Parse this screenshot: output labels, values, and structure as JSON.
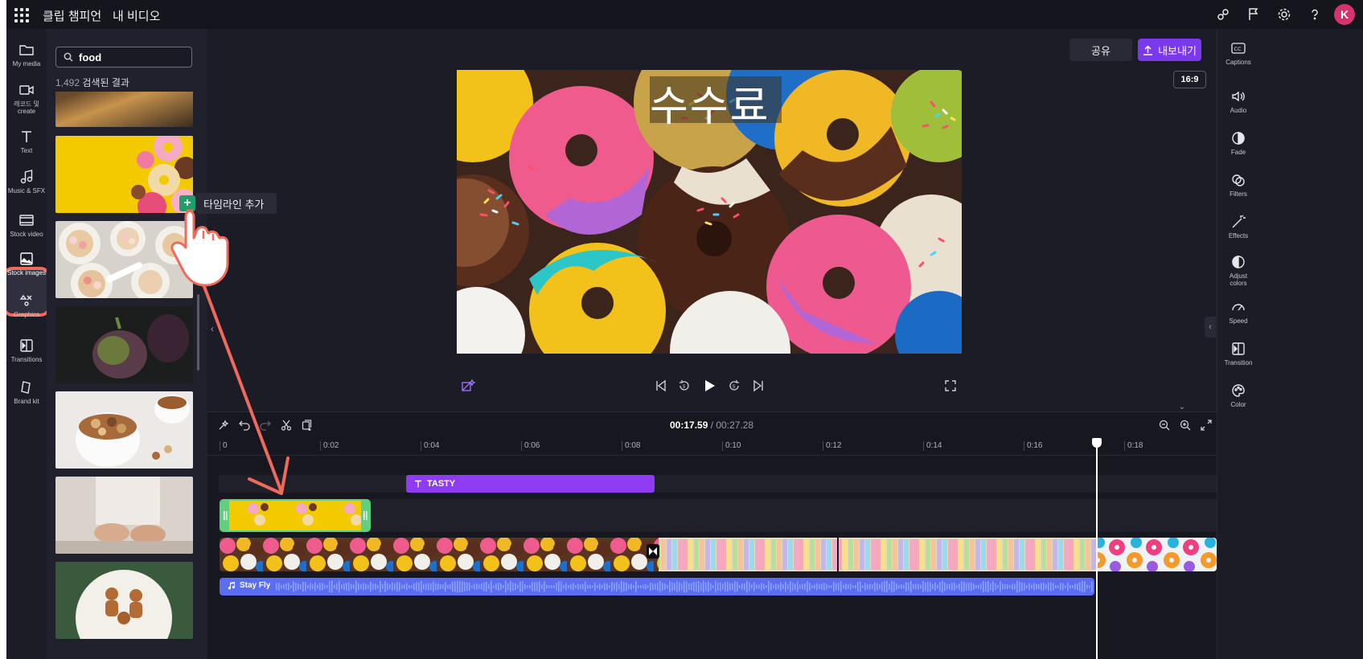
{
  "app": {
    "name": "클립 챔피언",
    "project": "내 비디오",
    "avatar_initial": "K"
  },
  "left_nav": [
    {
      "label": "My media",
      "icon": "folder-icon"
    },
    {
      "label": "레코드 및 create",
      "icon": "camera-icon"
    },
    {
      "label": "Text",
      "icon": "text-icon"
    },
    {
      "label": "Music & SFX",
      "icon": "music-note-icon"
    },
    {
      "label": "Stock video",
      "icon": "film-icon"
    },
    {
      "label": "Stock images",
      "icon": "image-icon"
    },
    {
      "label": "Graphics",
      "icon": "shapes-icon"
    },
    {
      "label": "Transitions",
      "icon": "transition-icon"
    },
    {
      "label": "Brand kit",
      "icon": "brand-kit-icon"
    }
  ],
  "search": {
    "value": "food",
    "result_count": "1,492",
    "result_text": "검색된 결과"
  },
  "tooltip": {
    "add_label": "+",
    "text": "타임라인 추가"
  },
  "preview": {
    "share_label": "공유",
    "export_label": "내보내기",
    "aspect_ratio": "16:9",
    "overlay_text": "수수료"
  },
  "right_nav": [
    {
      "label": "Captions",
      "icon": "captions-icon"
    },
    {
      "label": "Audio",
      "icon": "speaker-icon"
    },
    {
      "label": "Fade",
      "icon": "fade-icon"
    },
    {
      "label": "Filters",
      "icon": "filters-icon"
    },
    {
      "label": "Effects",
      "icon": "magic-wand-icon"
    },
    {
      "label": "Adjust colors",
      "icon": "contrast-icon"
    },
    {
      "label": "Speed",
      "icon": "speedometer-icon"
    },
    {
      "label": "Transition",
      "icon": "transition-icon"
    },
    {
      "label": "Color",
      "icon": "palette-icon"
    }
  ],
  "timeline": {
    "current_time": "00:17.59",
    "total_time": "/ 00:27.28",
    "ruler": [
      "0",
      "0:02",
      "0:04",
      "0:06",
      "0:08",
      "0:10",
      "0:12",
      "0:14",
      "0:16",
      "0:18"
    ],
    "text_clip": "TASTY",
    "audio_clip": "Stay Fly"
  },
  "colors": {
    "accent": "#7b39ec",
    "text_clip": "#8f3cf0",
    "audio_clip": "#5b6ef2",
    "highlight": "#f06a5c",
    "selected_clip": "#5ed07f"
  }
}
